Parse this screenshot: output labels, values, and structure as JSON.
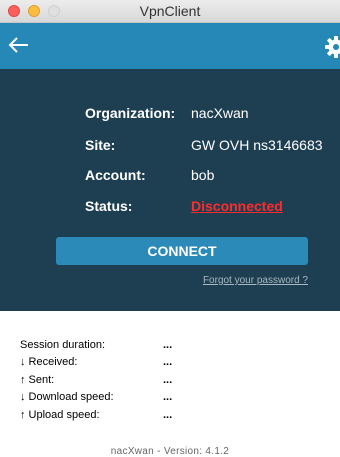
{
  "window": {
    "title": "VpnClient"
  },
  "icons": {
    "back": "arrow-left-icon",
    "settings": "gear-icon"
  },
  "info": {
    "organization_label": "Organization:",
    "organization_value": "nacXwan",
    "site_label": "Site:",
    "site_value": "GW OVH ns3146683",
    "account_label": "Account:",
    "account_value": "bob",
    "status_label": "Status:",
    "status_value": "Disconnected"
  },
  "actions": {
    "connect_label": "CONNECT",
    "forgot_label": "Forgot your password ?"
  },
  "stats": {
    "session_label": "Session duration:",
    "session_value": "...",
    "received_label": "↓ Received:",
    "received_value": "...",
    "sent_label": "↑ Sent:",
    "sent_value": "...",
    "download_label": "↓ Download speed:",
    "download_value": "...",
    "upload_label": "↑ Upload speed:",
    "upload_value": "..."
  },
  "footer": {
    "version": "nacXwan - Version: 4.1.2"
  },
  "colors": {
    "topbar": "#2588b6",
    "panel": "#1e3f52",
    "connect_button": "#2c8ab8",
    "status_disconnected": "#ff2a2a"
  }
}
